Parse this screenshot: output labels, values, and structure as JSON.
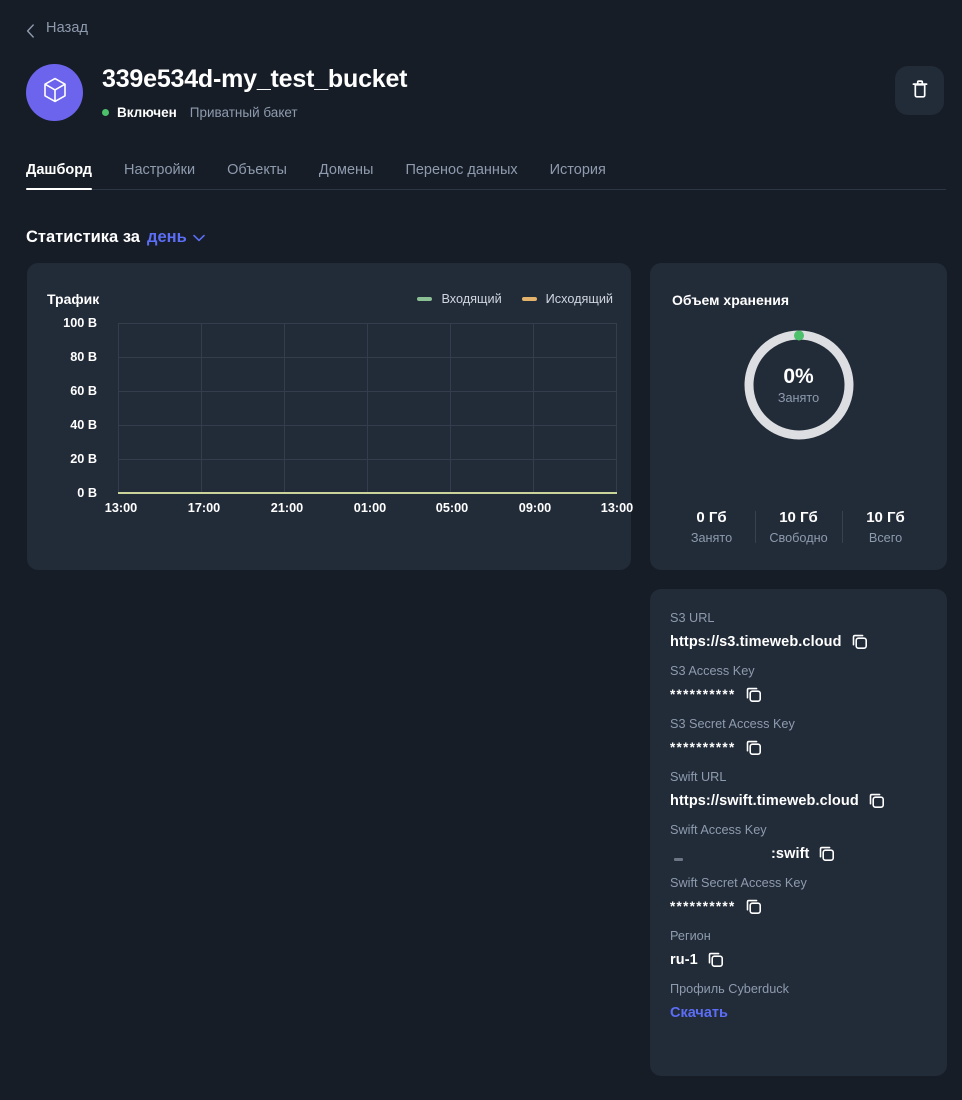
{
  "back": {
    "label": "Назад",
    "icon": "chevron-left-icon"
  },
  "header": {
    "title": "339e534d-my_test_bucket",
    "avatar_icon": "cube-icon",
    "status": "Включен",
    "access": "Приватный бакет",
    "delete_icon": "trash-icon",
    "accent": "#6c64ec",
    "status_color": "#4cc06a"
  },
  "tabs": [
    {
      "label": "Дашборд",
      "active": true
    },
    {
      "label": "Настройки",
      "active": false
    },
    {
      "label": "Объекты",
      "active": false
    },
    {
      "label": "Домены",
      "active": false
    },
    {
      "label": "Перенос данных",
      "active": false
    },
    {
      "label": "История",
      "active": false
    }
  ],
  "stats_header": {
    "lead": "Статистика за",
    "period": "день",
    "caret_icon": "chevron-down-icon",
    "link_color": "#5b6ef5"
  },
  "traffic": {
    "title": "Трафик",
    "legend": [
      {
        "label": "Входящий",
        "color": "#8bbf94"
      },
      {
        "label": "Исходящий",
        "color": "#e3b36c"
      }
    ]
  },
  "chart_data": {
    "type": "line",
    "title": "Трафик",
    "xlabel": "",
    "ylabel": "",
    "x": [
      "13:00",
      "17:00",
      "21:00",
      "01:00",
      "05:00",
      "09:00",
      "13:00"
    ],
    "yticks": [
      "0 B",
      "20 B",
      "40 B",
      "60 B",
      "80 B",
      "100 B"
    ],
    "ylim": [
      0,
      100
    ],
    "grid": true,
    "legend_position": "top-right",
    "series": [
      {
        "name": "Входящий",
        "color": "#8bbf94",
        "values": [
          0,
          0,
          0,
          0,
          0,
          0,
          0
        ]
      },
      {
        "name": "Исходящий",
        "color": "#e3b36c",
        "values": [
          0,
          0,
          0,
          0,
          0,
          0,
          0
        ]
      }
    ]
  },
  "storage": {
    "title": "Объем хранения",
    "percent": "0%",
    "percent_label": "Занято",
    "ring_color": "#dcdee1",
    "marker_color": "#4cc06a",
    "stats": [
      {
        "value": "0 Гб",
        "label": "Занято"
      },
      {
        "value": "10 Гб",
        "label": "Свободно"
      },
      {
        "value": "10 Гб",
        "label": "Всего"
      }
    ]
  },
  "credentials": [
    {
      "label": "S3 URL",
      "value": "https://s3.timeweb.cloud",
      "type": "text",
      "copy_icon": "copy-icon"
    },
    {
      "label": "S3 Access Key",
      "value": "**********",
      "type": "masked",
      "copy_icon": "copy-icon"
    },
    {
      "label": "S3 Secret Access Key",
      "value": "**********",
      "type": "masked",
      "copy_icon": "copy-icon"
    },
    {
      "label": "Swift URL",
      "value": "https://swift.timeweb.cloud",
      "type": "text",
      "copy_icon": "copy-icon"
    },
    {
      "label": "Swift Access Key",
      "value": ":swift",
      "type": "redacted",
      "copy_icon": "copy-icon"
    },
    {
      "label": "Swift Secret Access Key",
      "value": "**********",
      "type": "masked",
      "copy_icon": "copy-icon"
    },
    {
      "label": "Регион",
      "value": "ru-1",
      "type": "text",
      "copy_icon": "copy-icon"
    },
    {
      "label": "Профиль Cyberduck",
      "value": "Скачать",
      "type": "link"
    }
  ]
}
